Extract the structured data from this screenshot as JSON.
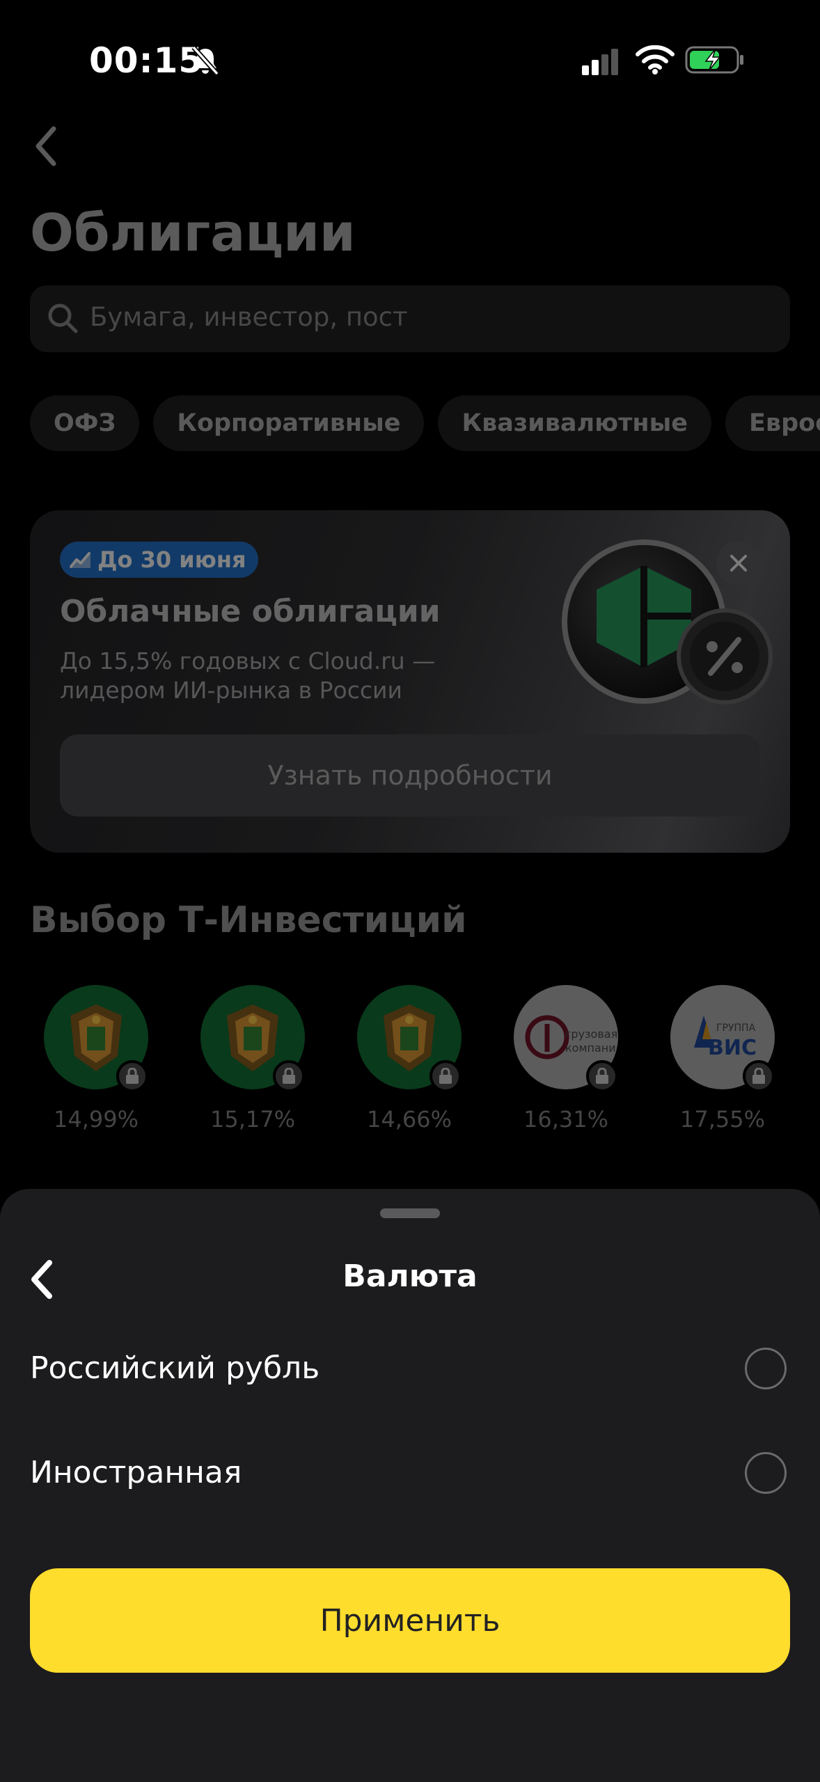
{
  "status_bar": {
    "time": "00:15"
  },
  "header": {
    "title": "Облигации"
  },
  "search": {
    "placeholder": "Бумага, инвестор, пост"
  },
  "chips": [
    "ОФЗ",
    "Корпоративные",
    "Квазивалютные",
    "Еврооблигации"
  ],
  "promo": {
    "badge": "До 30 июня",
    "title": "Облачные облигации",
    "description": "До 15,5% годовых с Cloud.ru — лидером ИИ-рынка в России",
    "button_label": "Узнать подробности"
  },
  "selection": {
    "title": "Выбор Т-Инвестиций",
    "bonds": [
      {
        "yield": "14,99%",
        "logo": "coat-of-arms"
      },
      {
        "yield": "15,17%",
        "logo": "coat-of-arms"
      },
      {
        "yield": "14,66%",
        "logo": "coat-of-arms"
      },
      {
        "yield": "16,31%",
        "logo": "gruzovaya-kompaniya",
        "logo_text": [
          "грузовая",
          "компания"
        ]
      },
      {
        "yield": "17,55%",
        "logo": "gruppa-vis",
        "logo_text": [
          "ГРУППА",
          "ВИС"
        ]
      }
    ]
  },
  "sheet": {
    "title": "Валюта",
    "options": [
      {
        "label": "Российский рубль",
        "selected": false
      },
      {
        "label": "Иностранная",
        "selected": false
      }
    ],
    "apply_label": "Применить"
  },
  "colors": {
    "accent": "#ffdd2d",
    "badge": "#1c5aa0",
    "sheet_bg": "#1c1c1e"
  }
}
